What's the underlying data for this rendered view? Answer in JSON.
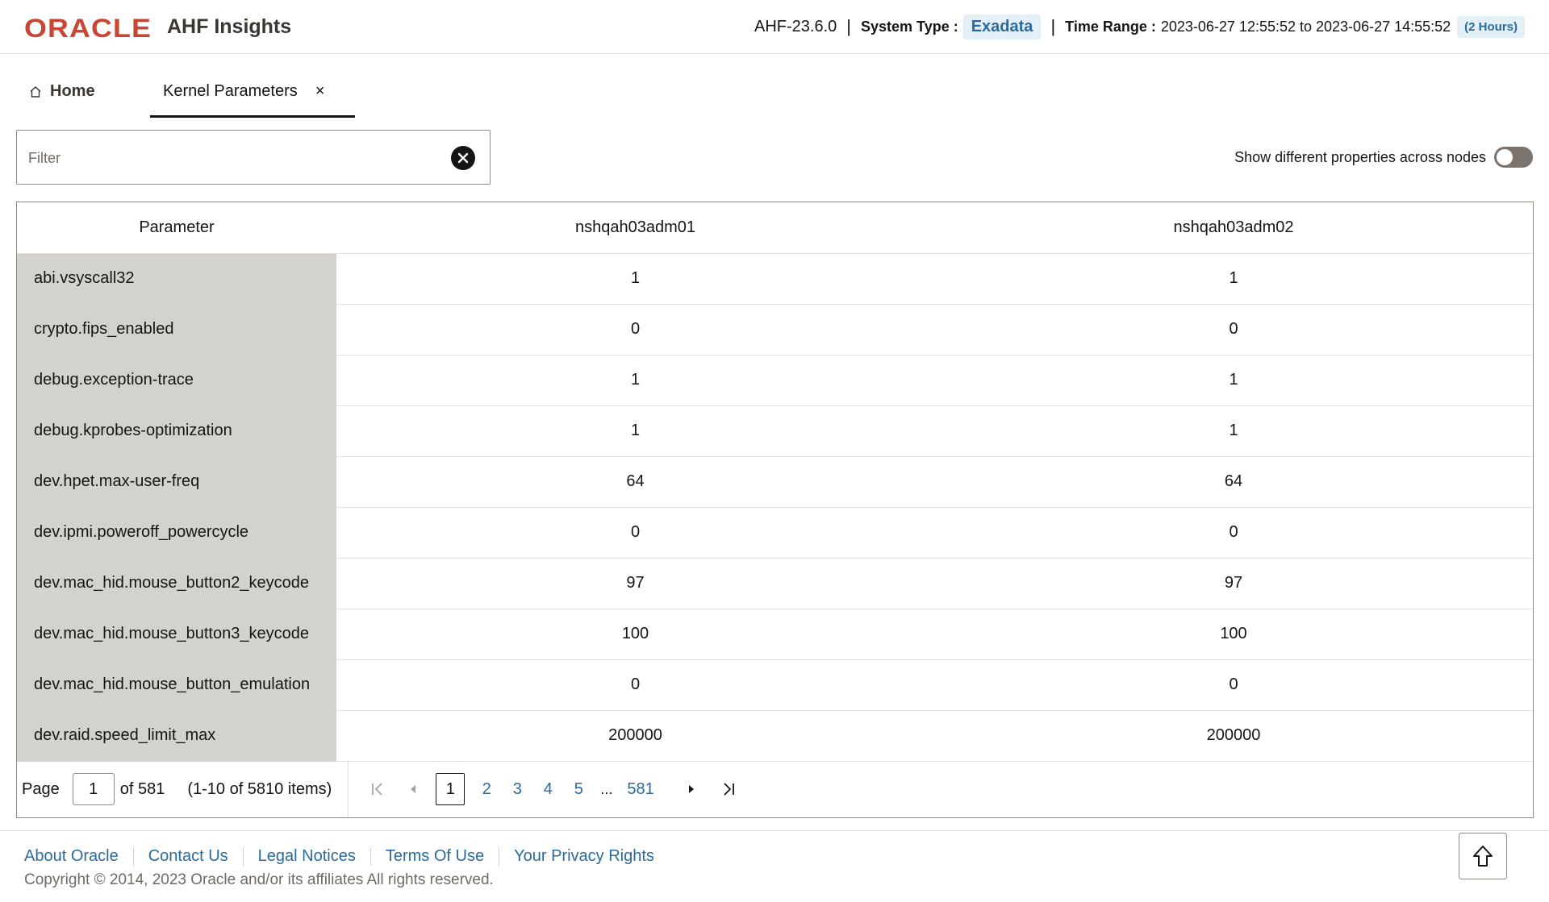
{
  "header": {
    "brand": "ORACLE",
    "app_name": "AHF Insights",
    "version": "AHF-23.6.0",
    "separator": "|",
    "system_type_label": "System Type :",
    "system_type_value": "Exadata",
    "time_range_label": "Time Range :",
    "time_range_value": "2023-06-27 12:55:52 to 2023-06-27 14:55:52",
    "time_range_duration": "(2 Hours)"
  },
  "tabs": [
    {
      "label": "Home",
      "icon": "home-icon",
      "active": false
    },
    {
      "label": "Kernel Parameters",
      "active": true,
      "close_icon": "close-icon",
      "close_glyph": "×"
    }
  ],
  "filter": {
    "placeholder": "Filter",
    "value": "",
    "clear_icon": "clear-icon"
  },
  "toggle": {
    "label": "Show different properties across nodes",
    "on": false
  },
  "table": {
    "columns": [
      "Parameter",
      "nshqah03adm01",
      "nshqah03adm02"
    ],
    "rows": [
      [
        "abi.vsyscall32",
        "1",
        "1"
      ],
      [
        "crypto.fips_enabled",
        "0",
        "0"
      ],
      [
        "debug.exception-trace",
        "1",
        "1"
      ],
      [
        "debug.kprobes-optimization",
        "1",
        "1"
      ],
      [
        "dev.hpet.max-user-freq",
        "64",
        "64"
      ],
      [
        "dev.ipmi.poweroff_powercycle",
        "0",
        "0"
      ],
      [
        "dev.mac_hid.mouse_button2_keycode",
        "97",
        "97"
      ],
      [
        "dev.mac_hid.mouse_button3_keycode",
        "100",
        "100"
      ],
      [
        "dev.mac_hid.mouse_button_emulation",
        "0",
        "0"
      ],
      [
        "dev.raid.speed_limit_max",
        "200000",
        "200000"
      ]
    ]
  },
  "pagination": {
    "page_label": "Page",
    "current_page": "1",
    "of_text": "of 581",
    "items_text": "(1-10 of 5810 items)",
    "pages": [
      "1",
      "2",
      "3",
      "4",
      "5"
    ],
    "ellipsis": "...",
    "last_page": "581"
  },
  "footer": {
    "links": [
      "About Oracle",
      "Contact Us",
      "Legal Notices",
      "Terms Of Use",
      "Your Privacy Rights"
    ],
    "copyright": "Copyright © 2014, 2023 Oracle and/or its affiliates All rights reserved.",
    "scroll_top_icon": "arrow-up-icon"
  },
  "colors": {
    "brand_red": "#c74634",
    "link_blue": "#2b6a9e",
    "pill_bg": "#e4f0f7",
    "param_bg": "#d4d2cf"
  }
}
